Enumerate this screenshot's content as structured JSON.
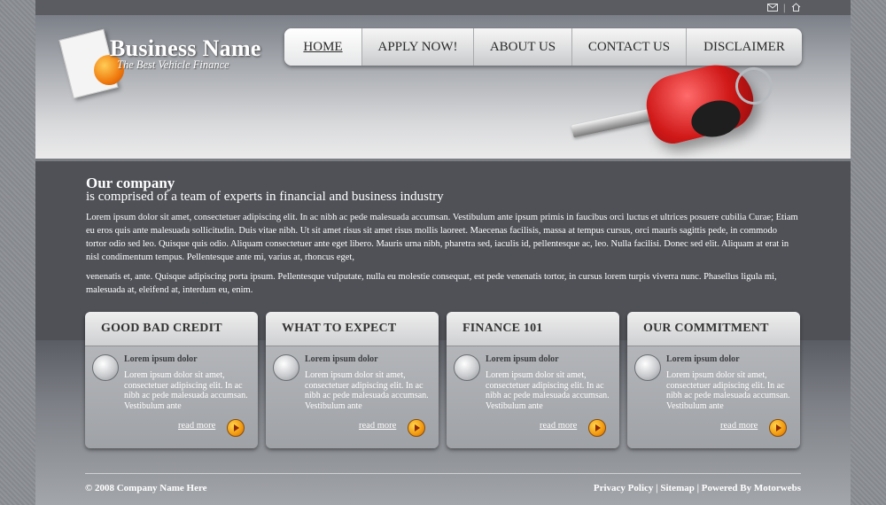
{
  "brand": {
    "name": "Business Name",
    "tagline": "The Best Vehicle Finance"
  },
  "topbar": {
    "separator": "|"
  },
  "nav": {
    "items": [
      {
        "label": "HOME"
      },
      {
        "label": "APPLY NOW!"
      },
      {
        "label": "ABOUT US"
      },
      {
        "label": "CONTACT US"
      },
      {
        "label": "DISCLAIMER"
      }
    ]
  },
  "intro": {
    "title": "Our company",
    "subtitle": "is comprised of a team of experts in financial and business industry",
    "paragraph1": "Lorem ipsum dolor sit amet, consectetuer adipiscing elit. In ac nibh ac pede malesuada accumsan. Vestibulum ante ipsum primis in faucibus orci luctus et ultrices posuere cubilia  Curae; Etiam eu eros quis ante malesuada sollicitudin. Duis vitae nibh. Ut sit amet risus sit amet risus mollis laoreet. Maecenas facilisis, massa at tempus cursus, orci mauris sagittis pede, in commodo tortor odio sed leo. Quisque quis odio. Aliquam consectetuer ante eget libero. Mauris urna nibh, pharetra sed, iaculis id, pellentesque ac, leo. Nulla facilisi. Donec sed elit. Aliquam at erat in nisl condimentum tempus. Pellentesque ante mi, varius at, rhoncus eget,",
    "paragraph2": "venenatis et, ante. Quisque adipiscing porta ipsum. Pellentesque vulputate, nulla eu molestie consequat, est pede venenatis tortor, in cursus lorem turpis viverra nunc. Phasellus ligula mi, malesuada at, eleifend at, interdum eu, enim."
  },
  "boxes": [
    {
      "title": "GOOD BAD CREDIT",
      "subtitle": "Lorem ipsum dolor",
      "text": "Lorem ipsum dolor sit amet, consectetuer adipiscing elit. In ac nibh ac pede malesuada accumsan. Vestibulum ante",
      "link": "read more"
    },
    {
      "title": "WHAT TO EXPECT",
      "subtitle": "Lorem ipsum dolor",
      "text": "Lorem ipsum dolor sit amet, consectetuer adipiscing elit. In ac nibh ac pede malesuada accumsan. Vestibulum ante",
      "link": "read more"
    },
    {
      "title": "FINANCE 101",
      "subtitle": "Lorem ipsum dolor",
      "text": "Lorem ipsum dolor sit amet, consectetuer adipiscing elit. In ac nibh ac pede malesuada accumsan. Vestibulum ante",
      "link": "read more"
    },
    {
      "title": "OUR COMMITMENT",
      "subtitle": "Lorem ipsum dolor",
      "text": "Lorem ipsum dolor sit amet, consectetuer adipiscing elit. In ac nibh ac pede malesuada accumsan. Vestibulum ante",
      "link": "read more"
    }
  ],
  "footer": {
    "copyright": "© 2008 Company Name Here",
    "privacy": "Privacy Policy",
    "sitemap": "Sitemap",
    "powered": "Powered By Motorwebs",
    "sep": "|"
  },
  "icons": {
    "top_left": "mail-icon",
    "top_right": "home-icon"
  }
}
